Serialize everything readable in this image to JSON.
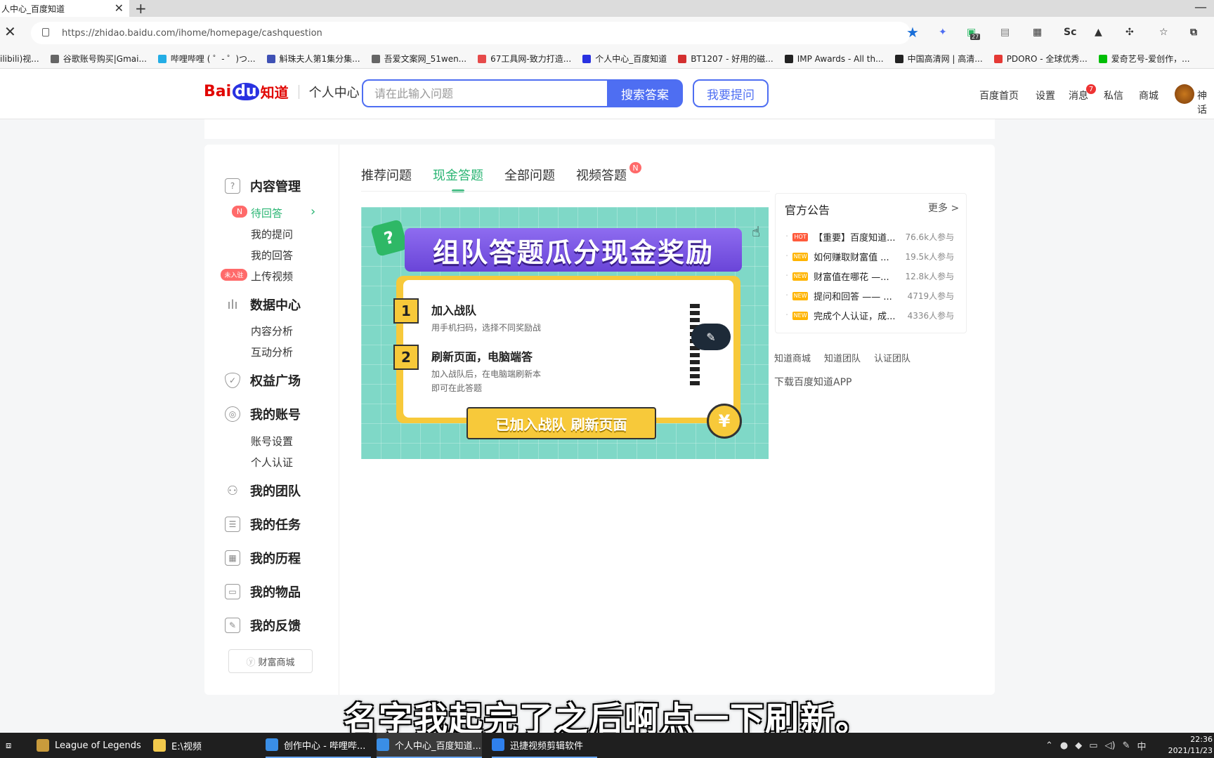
{
  "browser": {
    "tab_title": "人中心_百度知道",
    "url": "https://zhidao.baidu.com/ihome/homepage/cashquestion",
    "ext_badge": "27",
    "ext_sc": "Sc",
    "bookmarks": [
      {
        "label": "ilibili)视...",
        "color": "#fb7299"
      },
      {
        "label": "谷歌账号购买|Gmai...",
        "color": "#666"
      },
      {
        "label": "哔哩哔哩 ( ゜- ゜)つ...",
        "color": "#23ade5"
      },
      {
        "label": "斛珠夫人第1集分集...",
        "color": "#3f51b5"
      },
      {
        "label": "吾爱文案网_51wen...",
        "color": "#666"
      },
      {
        "label": "67工具网-致力打造...",
        "color": "#e64a4a"
      },
      {
        "label": "个人中心_百度知道",
        "color": "#2932e1"
      },
      {
        "label": "BT1207 - 好用的磁...",
        "color": "#d32f2f"
      },
      {
        "label": "IMP Awards - All th...",
        "color": "#222"
      },
      {
        "label": "中国高清网 | 高清...",
        "color": "#222"
      },
      {
        "label": "PDORO - 全球优秀...",
        "color": "#e53935"
      },
      {
        "label": "爱奇艺号-爱创作，...",
        "color": "#00be06"
      }
    ]
  },
  "header": {
    "logo_bai": "Bai",
    "logo_du": "du",
    "logo_zd": "知道",
    "section": "个人中心",
    "search_placeholder": "请在此输入问题",
    "search_button": "搜索答案",
    "ask_button": "我要提问",
    "nav": [
      "百度首页",
      "设置",
      "消息",
      "私信",
      "商城",
      "神话"
    ],
    "msg_count": "7"
  },
  "sidebar": {
    "content_mgmt": "内容管理",
    "pending_badge": "N",
    "pending": "待回答",
    "my_questions": "我的提问",
    "my_answers": "我的回答",
    "upload_badge": "未入驻",
    "upload_video": "上传视频",
    "data_center": "数据中心",
    "content_analysis": "内容分析",
    "interaction_analysis": "互动分析",
    "benefits": "权益广场",
    "my_account": "我的账号",
    "account_settings": "账号设置",
    "personal_auth": "个人认证",
    "my_team": "我的团队",
    "my_tasks": "我的任务",
    "my_history": "我的历程",
    "my_items": "我的物品",
    "my_feedback": "我的反馈",
    "wealth_mall": "财富商城"
  },
  "tabs": {
    "recommended": "推荐问题",
    "cash": "现金答题",
    "all": "全部问题",
    "video": "视频答题",
    "video_badge": "N"
  },
  "banner": {
    "title": "组队答题瓜分现金奖励",
    "step1_num": "1",
    "step1_title": "加入战队",
    "step1_desc": "用手机扫码，选择不同奖励战",
    "step2_num": "2",
    "step2_title": "刷新页面，电脑端答",
    "step2_desc": "加入战队后，在电脑端刷新本 即可在此答题",
    "button": "已加入战队  刷新页面",
    "coin": "¥"
  },
  "notice": {
    "title": "官方公告",
    "more": "更多 >",
    "items": [
      {
        "tag": "HOT",
        "tag_color": "#ff5a3c",
        "text": "【重要】百度知道...",
        "count": "76.6k人参与"
      },
      {
        "tag": "NEW",
        "tag_color": "#ffb400",
        "text": "如何赚取财富值 ...",
        "count": "19.5k人参与"
      },
      {
        "tag": "NEW",
        "tag_color": "#ffb400",
        "text": "财富值在哪花 —...",
        "count": "12.8k人参与"
      },
      {
        "tag": "NEW",
        "tag_color": "#ffb400",
        "text": "提问和回答 —— ...",
        "count": "4719人参与"
      },
      {
        "tag": "NEW",
        "tag_color": "#ffb400",
        "text": "完成个人认证，成...",
        "count": "4336人参与"
      }
    ]
  },
  "footer_links": {
    "mall": "知道商城",
    "team": "知道团队",
    "auth_team": "认证团队",
    "download": "下载百度知道APP"
  },
  "subtitle": "名字我起完了之后啊点一下刷新。",
  "taskbar": {
    "items": [
      {
        "label": "League of Legends",
        "color": "#c89b3c"
      },
      {
        "label": "E:\\视频",
        "color": "#f2c94c"
      },
      {
        "label": "创作中心 - 哔哩哔...",
        "color": "#3a8ee6"
      },
      {
        "label": "个人中心_百度知道...",
        "color": "#3a8ee6"
      },
      {
        "label": "迅捷视频剪辑软件",
        "color": "#2f80ed"
      }
    ],
    "ime": "中",
    "time": "22:36",
    "date": "2021/11/23"
  }
}
